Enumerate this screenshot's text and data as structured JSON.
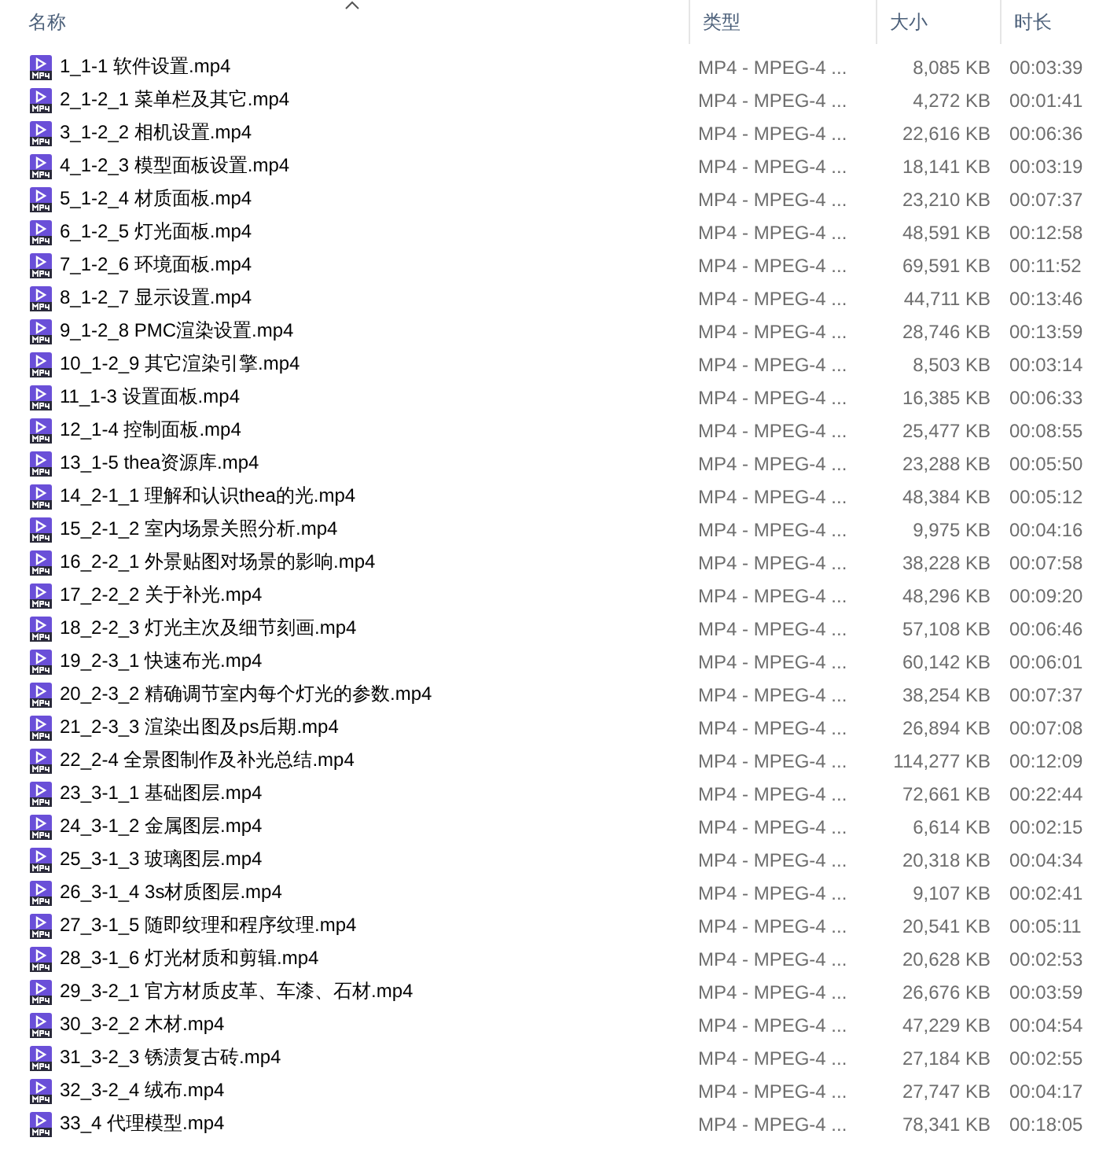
{
  "columns": [
    {
      "label": "名称",
      "sorted": true
    },
    {
      "label": "类型",
      "sorted": false
    },
    {
      "label": "大小",
      "sorted": false
    },
    {
      "label": "时长",
      "sorted": false
    }
  ],
  "files": [
    {
      "name": "1_1-1 软件设置.mp4",
      "type": "MP4 - MPEG-4 ...",
      "size": "8,085 KB",
      "duration": "00:03:39"
    },
    {
      "name": "2_1-2_1 菜单栏及其它.mp4",
      "type": "MP4 - MPEG-4 ...",
      "size": "4,272 KB",
      "duration": "00:01:41"
    },
    {
      "name": "3_1-2_2 相机设置.mp4",
      "type": "MP4 - MPEG-4 ...",
      "size": "22,616 KB",
      "duration": "00:06:36"
    },
    {
      "name": "4_1-2_3 模型面板设置.mp4",
      "type": "MP4 - MPEG-4 ...",
      "size": "18,141 KB",
      "duration": "00:03:19"
    },
    {
      "name": "5_1-2_4 材质面板.mp4",
      "type": "MP4 - MPEG-4 ...",
      "size": "23,210 KB",
      "duration": "00:07:37"
    },
    {
      "name": "6_1-2_5 灯光面板.mp4",
      "type": "MP4 - MPEG-4 ...",
      "size": "48,591 KB",
      "duration": "00:12:58"
    },
    {
      "name": "7_1-2_6 环境面板.mp4",
      "type": "MP4 - MPEG-4 ...",
      "size": "69,591 KB",
      "duration": "00:11:52"
    },
    {
      "name": "8_1-2_7 显示设置.mp4",
      "type": "MP4 - MPEG-4 ...",
      "size": "44,711 KB",
      "duration": "00:13:46"
    },
    {
      "name": "9_1-2_8 PMC渲染设置.mp4",
      "type": "MP4 - MPEG-4 ...",
      "size": "28,746 KB",
      "duration": "00:13:59"
    },
    {
      "name": "10_1-2_9 其它渲染引擎.mp4",
      "type": "MP4 - MPEG-4 ...",
      "size": "8,503 KB",
      "duration": "00:03:14"
    },
    {
      "name": "11_1-3 设置面板.mp4",
      "type": "MP4 - MPEG-4 ...",
      "size": "16,385 KB",
      "duration": "00:06:33"
    },
    {
      "name": "12_1-4 控制面板.mp4",
      "type": "MP4 - MPEG-4 ...",
      "size": "25,477 KB",
      "duration": "00:08:55"
    },
    {
      "name": "13_1-5 thea资源库.mp4",
      "type": "MP4 - MPEG-4 ...",
      "size": "23,288 KB",
      "duration": "00:05:50"
    },
    {
      "name": "14_2-1_1 理解和认识thea的光.mp4",
      "type": "MP4 - MPEG-4 ...",
      "size": "48,384 KB",
      "duration": "00:05:12"
    },
    {
      "name": "15_2-1_2 室内场景关照分析.mp4",
      "type": "MP4 - MPEG-4 ...",
      "size": "9,975 KB",
      "duration": "00:04:16"
    },
    {
      "name": "16_2-2_1 外景贴图对场景的影响.mp4",
      "type": "MP4 - MPEG-4 ...",
      "size": "38,228 KB",
      "duration": "00:07:58"
    },
    {
      "name": "17_2-2_2 关于补光.mp4",
      "type": "MP4 - MPEG-4 ...",
      "size": "48,296 KB",
      "duration": "00:09:20"
    },
    {
      "name": "18_2-2_3 灯光主次及细节刻画.mp4",
      "type": "MP4 - MPEG-4 ...",
      "size": "57,108 KB",
      "duration": "00:06:46"
    },
    {
      "name": "19_2-3_1 快速布光.mp4",
      "type": "MP4 - MPEG-4 ...",
      "size": "60,142 KB",
      "duration": "00:06:01"
    },
    {
      "name": "20_2-3_2 精确调节室内每个灯光的参数.mp4",
      "type": "MP4 - MPEG-4 ...",
      "size": "38,254 KB",
      "duration": "00:07:37"
    },
    {
      "name": "21_2-3_3 渲染出图及ps后期.mp4",
      "type": "MP4 - MPEG-4 ...",
      "size": "26,894 KB",
      "duration": "00:07:08"
    },
    {
      "name": "22_2-4 全景图制作及补光总结.mp4",
      "type": "MP4 - MPEG-4 ...",
      "size": "114,277 KB",
      "duration": "00:12:09"
    },
    {
      "name": "23_3-1_1 基础图层.mp4",
      "type": "MP4 - MPEG-4 ...",
      "size": "72,661 KB",
      "duration": "00:22:44"
    },
    {
      "name": "24_3-1_2 金属图层.mp4",
      "type": "MP4 - MPEG-4 ...",
      "size": "6,614 KB",
      "duration": "00:02:15"
    },
    {
      "name": "25_3-1_3 玻璃图层.mp4",
      "type": "MP4 - MPEG-4 ...",
      "size": "20,318 KB",
      "duration": "00:04:34"
    },
    {
      "name": "26_3-1_4 3s材质图层.mp4",
      "type": "MP4 - MPEG-4 ...",
      "size": "9,107 KB",
      "duration": "00:02:41"
    },
    {
      "name": "27_3-1_5 随即纹理和程序纹理.mp4",
      "type": "MP4 - MPEG-4 ...",
      "size": "20,541 KB",
      "duration": "00:05:11"
    },
    {
      "name": "28_3-1_6 灯光材质和剪辑.mp4",
      "type": "MP4 - MPEG-4 ...",
      "size": "20,628 KB",
      "duration": "00:02:53"
    },
    {
      "name": "29_3-2_1 官方材质皮革、车漆、石材.mp4",
      "type": "MP4 - MPEG-4 ...",
      "size": "26,676 KB",
      "duration": "00:03:59"
    },
    {
      "name": "30_3-2_2 木材.mp4",
      "type": "MP4 - MPEG-4 ...",
      "size": "47,229 KB",
      "duration": "00:04:54"
    },
    {
      "name": "31_3-2_3 锈渍复古砖.mp4",
      "type": "MP4 - MPEG-4 ...",
      "size": "27,184 KB",
      "duration": "00:02:55"
    },
    {
      "name": "32_3-2_4 绒布.mp4",
      "type": "MP4 - MPEG-4 ...",
      "size": "27,747 KB",
      "duration": "00:04:17"
    },
    {
      "name": "33_4 代理模型.mp4",
      "type": "MP4 - MPEG-4 ...",
      "size": "78,341 KB",
      "duration": "00:18:05"
    }
  ]
}
